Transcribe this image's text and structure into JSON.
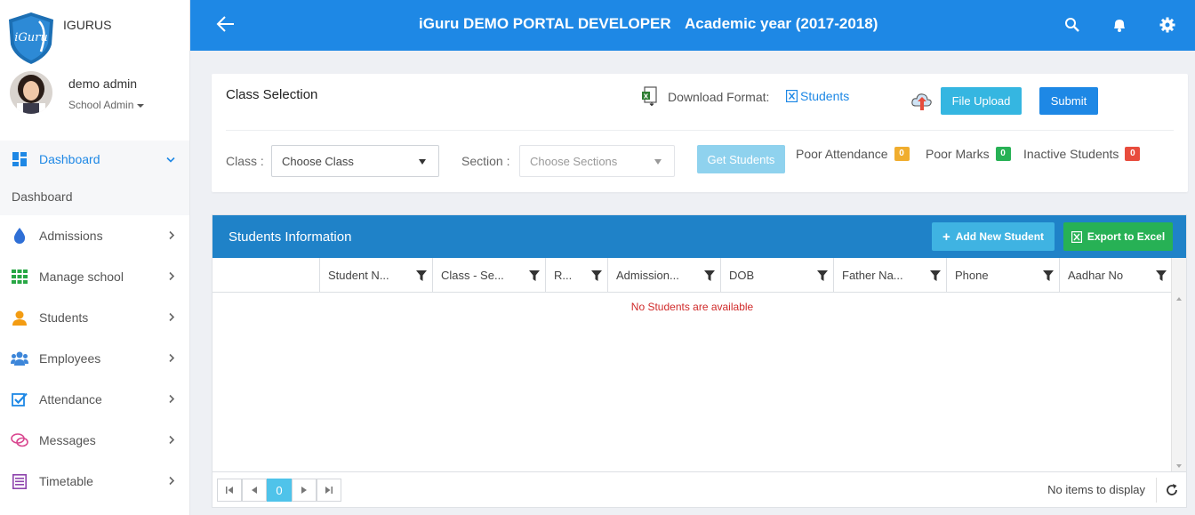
{
  "brand": {
    "logo_text": "iGuru",
    "name": "IGURUS"
  },
  "user": {
    "name": "demo admin",
    "role": "School Admin"
  },
  "sidebar": {
    "items": [
      {
        "label": "Dashboard",
        "icon": "dashboard-icon",
        "active": true
      },
      {
        "label": "Admissions",
        "icon": "drop-icon"
      },
      {
        "label": "Manage school",
        "icon": "grid-icon"
      },
      {
        "label": "Students",
        "icon": "user-icon"
      },
      {
        "label": "Employees",
        "icon": "users-icon"
      },
      {
        "label": "Attendance",
        "icon": "checkbox-icon"
      },
      {
        "label": "Messages",
        "icon": "chat-icon"
      },
      {
        "label": "Timetable",
        "icon": "list-icon"
      }
    ],
    "submenu": [
      "Dashboard"
    ]
  },
  "header": {
    "title": "iGuru DEMO PORTAL DEVELOPER",
    "academic_year": "Academic year (2017-2018)",
    "color": "#1e88e5"
  },
  "class_selection": {
    "title": "Class Selection",
    "download_label": "Download Format:",
    "download_link": "Students",
    "upload_button": "File Upload",
    "submit_button": "Submit",
    "class_label": "Class :",
    "class_placeholder": "Choose Class",
    "section_label": "Section :",
    "section_placeholder": "Choose Sections",
    "get_button": "Get Students",
    "stats": [
      {
        "label": "Poor Attendance",
        "count": "0",
        "color": "#f0ad2e"
      },
      {
        "label": "Poor Marks",
        "count": "0",
        "color": "#27b155"
      },
      {
        "label": "Inactive Students",
        "count": "0",
        "color": "#e84c3d"
      }
    ]
  },
  "students": {
    "title": "Students Information",
    "add_button": "Add New Student",
    "export_button": "Export to Excel",
    "columns": [
      "Student N...",
      "Class - Se...",
      "R...",
      "Admission...",
      "DOB",
      "Father Na...",
      "Phone",
      "Aadhar No"
    ],
    "empty_message": "No Students are available",
    "pager": {
      "current_page": "0",
      "info": "No items to display"
    }
  }
}
